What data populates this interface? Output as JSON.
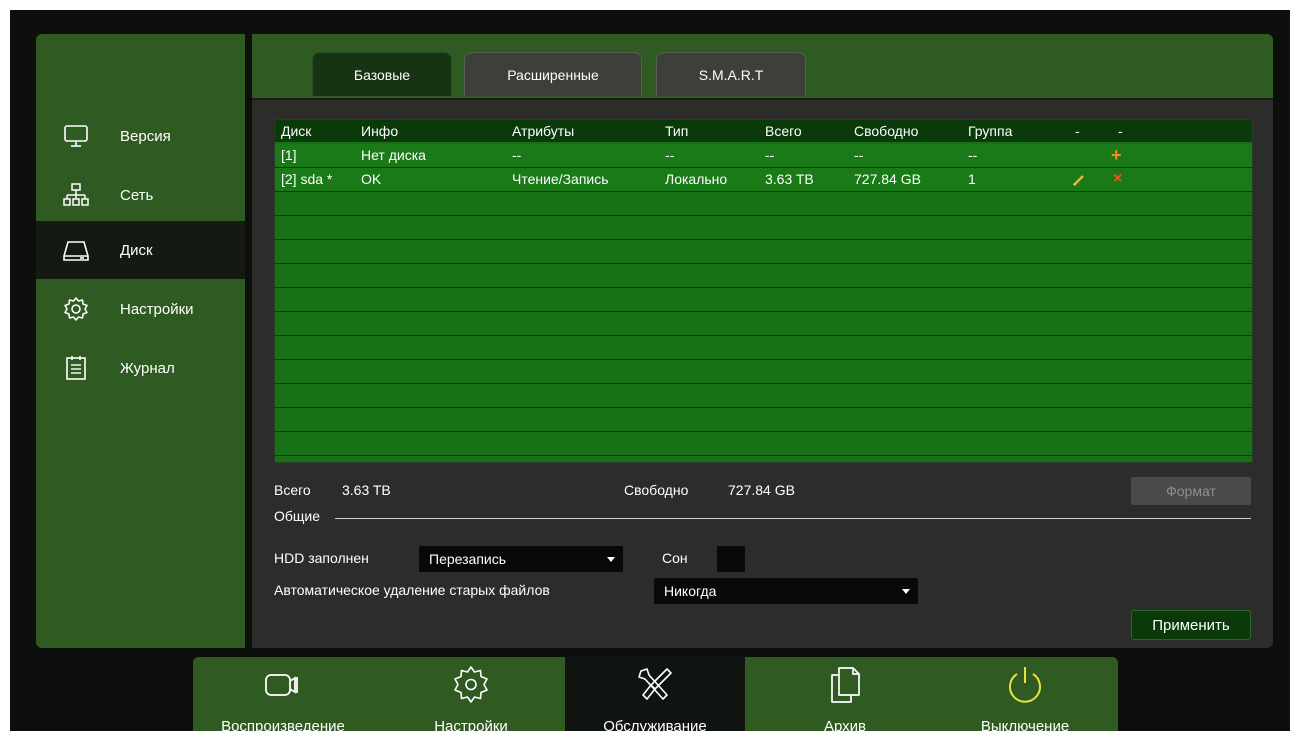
{
  "sidebar": {
    "items": [
      {
        "label": "Версия",
        "icon": "monitor-icon"
      },
      {
        "label": "Сеть",
        "icon": "network-icon"
      },
      {
        "label": "Диск",
        "icon": "hdd-icon",
        "active": true
      },
      {
        "label": "Настройки",
        "icon": "gear-icon"
      },
      {
        "label": "Журнал",
        "icon": "log-icon"
      }
    ]
  },
  "tabs": [
    {
      "label": "Базовые",
      "active": true
    },
    {
      "label": "Расширенные",
      "active": false
    },
    {
      "label": "S.M.A.R.T",
      "active": false
    }
  ],
  "table": {
    "headers": [
      "Диск",
      "Инфо",
      "Атрибуты",
      "Тип",
      "Всего",
      "Свободно",
      "Группа",
      "-",
      "-"
    ],
    "rows": [
      {
        "disk": "[1]",
        "info": "Нет диска",
        "attr": "--",
        "type": "--",
        "total": "--",
        "free": "--",
        "group": "--",
        "edit": "",
        "action": "+"
      },
      {
        "disk": "[2] sda *",
        "info": "OK",
        "attr": "Чтение/Запись",
        "type": "Локально",
        "total": "3.63 TB",
        "free": "727.84 GB",
        "group": "1",
        "edit": "pencil-icon",
        "action": "×"
      }
    ]
  },
  "summary": {
    "total_label": "Всего",
    "total_value": "3.63 TB",
    "free_label": "Свободно",
    "free_value": "727.84 GB",
    "format_label": "Формат"
  },
  "general": {
    "section_label": "Общие",
    "hdd_full_label": "HDD заполнен",
    "hdd_full_value": "Перезапись",
    "sleep_label": "Сон",
    "autodelete_label": "Автоматическое удаление старых файлов",
    "autodelete_value": "Никогда",
    "apply_label": "Применить"
  },
  "dock": [
    {
      "label": "Воспроизведение",
      "icon": "camera-icon"
    },
    {
      "label": "Настройки",
      "icon": "gear-icon"
    },
    {
      "label": "Обслуживание",
      "icon": "tools-icon",
      "active": true
    },
    {
      "label": "Архив",
      "icon": "archive-icon"
    },
    {
      "label": "Выключение",
      "icon": "power-icon"
    }
  ],
  "colors": {
    "panel_green": "#2f5a22",
    "table_green": "#1a7a18",
    "power_yellow": "#e8e23a",
    "plus_orange": "#ff8a1a",
    "delete_red": "#ff4a22"
  }
}
